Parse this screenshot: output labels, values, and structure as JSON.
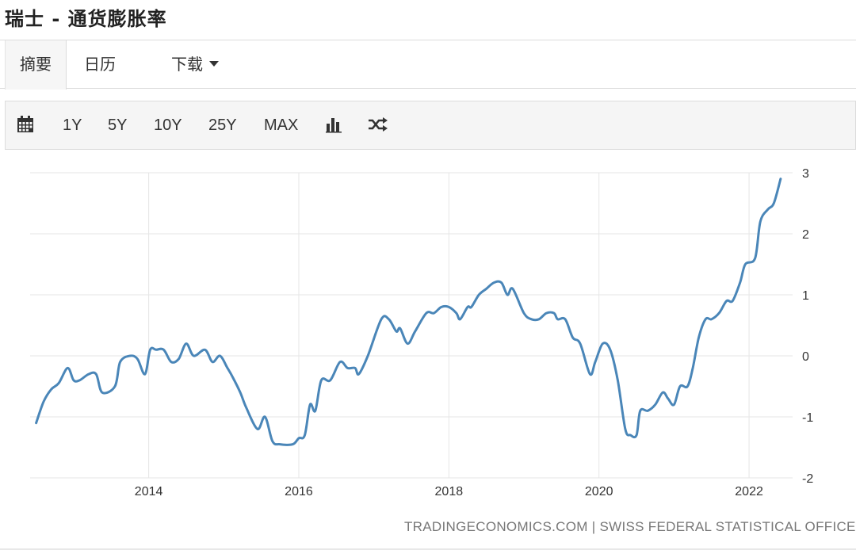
{
  "page": {
    "title": "瑞士 - 通货膨胀率"
  },
  "tabs": {
    "summary": "摘要",
    "calendar": "日历",
    "download": "下载"
  },
  "toolbar": {
    "range_1y": "1Y",
    "range_5y": "5Y",
    "range_10y": "10Y",
    "range_25y": "25Y",
    "range_max": "MAX",
    "icons": [
      "calendar-icon",
      "bar-chart-icon",
      "shuffle-icon"
    ]
  },
  "source": "TRADINGECONOMICS.COM | SWISS FEDERAL STATISTICAL OFFICE",
  "colors": {
    "line": "#4a86b8",
    "grid": "#e6e6e6",
    "axis_text": "#333333"
  },
  "chart_data": {
    "type": "line",
    "title": "",
    "xlabel": "",
    "ylabel": "",
    "xlim": [
      2012.42,
      2022.58
    ],
    "ylim": [
      -2,
      3
    ],
    "x_ticks": [
      2014,
      2016,
      2018,
      2020,
      2022
    ],
    "y_ticks": [
      3,
      2,
      1,
      0,
      -1,
      -2
    ],
    "y_axis_position": "right",
    "grid": true,
    "series": [
      {
        "name": "",
        "points": [
          [
            2012.5,
            -1.1
          ],
          [
            2012.6,
            -0.75
          ],
          [
            2012.7,
            -0.55
          ],
          [
            2012.8,
            -0.45
          ],
          [
            2012.92,
            -0.2
          ],
          [
            2013.0,
            -0.4
          ],
          [
            2013.08,
            -0.4
          ],
          [
            2013.2,
            -0.3
          ],
          [
            2013.3,
            -0.3
          ],
          [
            2013.38,
            -0.6
          ],
          [
            2013.55,
            -0.5
          ],
          [
            2013.62,
            -0.1
          ],
          [
            2013.75,
            0.0
          ],
          [
            2013.85,
            -0.05
          ],
          [
            2013.95,
            -0.3
          ],
          [
            2014.02,
            0.1
          ],
          [
            2014.1,
            0.1
          ],
          [
            2014.2,
            0.1
          ],
          [
            2014.3,
            -0.1
          ],
          [
            2014.4,
            -0.05
          ],
          [
            2014.5,
            0.2
          ],
          [
            2014.6,
            0.0
          ],
          [
            2014.75,
            0.1
          ],
          [
            2014.85,
            -0.1
          ],
          [
            2014.95,
            0.0
          ],
          [
            2015.05,
            -0.2
          ],
          [
            2015.12,
            -0.35
          ],
          [
            2015.22,
            -0.6
          ],
          [
            2015.3,
            -0.85
          ],
          [
            2015.45,
            -1.2
          ],
          [
            2015.55,
            -1.0
          ],
          [
            2015.65,
            -1.4
          ],
          [
            2015.75,
            -1.45
          ],
          [
            2015.92,
            -1.45
          ],
          [
            2016.0,
            -1.35
          ],
          [
            2016.08,
            -1.3
          ],
          [
            2016.15,
            -0.8
          ],
          [
            2016.22,
            -0.9
          ],
          [
            2016.3,
            -0.4
          ],
          [
            2016.42,
            -0.4
          ],
          [
            2016.55,
            -0.1
          ],
          [
            2016.65,
            -0.2
          ],
          [
            2016.75,
            -0.2
          ],
          [
            2016.8,
            -0.3
          ],
          [
            2016.92,
            0.0
          ],
          [
            2017.1,
            0.6
          ],
          [
            2017.2,
            0.6
          ],
          [
            2017.3,
            0.4
          ],
          [
            2017.35,
            0.45
          ],
          [
            2017.45,
            0.2
          ],
          [
            2017.55,
            0.4
          ],
          [
            2017.7,
            0.7
          ],
          [
            2017.8,
            0.7
          ],
          [
            2017.9,
            0.8
          ],
          [
            2018.0,
            0.8
          ],
          [
            2018.1,
            0.7
          ],
          [
            2018.15,
            0.6
          ],
          [
            2018.25,
            0.8
          ],
          [
            2018.3,
            0.8
          ],
          [
            2018.4,
            1.0
          ],
          [
            2018.5,
            1.1
          ],
          [
            2018.6,
            1.2
          ],
          [
            2018.7,
            1.2
          ],
          [
            2018.78,
            1.0
          ],
          [
            2018.85,
            1.1
          ],
          [
            2019.0,
            0.7
          ],
          [
            2019.1,
            0.6
          ],
          [
            2019.2,
            0.6
          ],
          [
            2019.3,
            0.7
          ],
          [
            2019.4,
            0.7
          ],
          [
            2019.45,
            0.6
          ],
          [
            2019.55,
            0.6
          ],
          [
            2019.65,
            0.3
          ],
          [
            2019.75,
            0.2
          ],
          [
            2019.88,
            -0.3
          ],
          [
            2019.95,
            -0.1
          ],
          [
            2020.05,
            0.2
          ],
          [
            2020.15,
            0.1
          ],
          [
            2020.25,
            -0.4
          ],
          [
            2020.35,
            -1.2
          ],
          [
            2020.42,
            -1.3
          ],
          [
            2020.5,
            -1.3
          ],
          [
            2020.55,
            -0.9
          ],
          [
            2020.65,
            -0.9
          ],
          [
            2020.75,
            -0.8
          ],
          [
            2020.85,
            -0.6
          ],
          [
            2020.92,
            -0.7
          ],
          [
            2021.0,
            -0.8
          ],
          [
            2021.08,
            -0.5
          ],
          [
            2021.18,
            -0.5
          ],
          [
            2021.25,
            -0.2
          ],
          [
            2021.33,
            0.3
          ],
          [
            2021.42,
            0.6
          ],
          [
            2021.5,
            0.6
          ],
          [
            2021.6,
            0.7
          ],
          [
            2021.7,
            0.9
          ],
          [
            2021.78,
            0.9
          ],
          [
            2021.88,
            1.2
          ],
          [
            2021.95,
            1.5
          ],
          [
            2022.08,
            1.6
          ],
          [
            2022.15,
            2.2
          ],
          [
            2022.25,
            2.4
          ],
          [
            2022.33,
            2.5
          ],
          [
            2022.42,
            2.9
          ]
        ]
      }
    ]
  }
}
